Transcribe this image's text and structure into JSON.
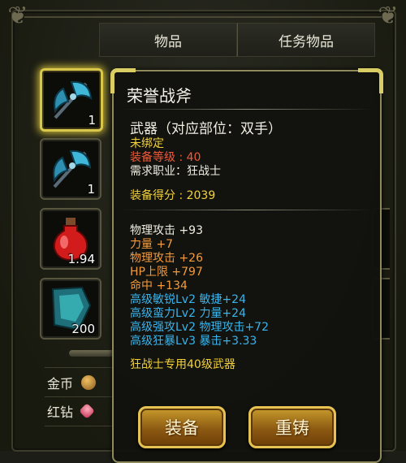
{
  "tabs": [
    {
      "label": "物品"
    },
    {
      "label": "任务物品"
    }
  ],
  "inventory": [
    {
      "icon": "battle-axe-icon",
      "qty": "1",
      "selected": true
    },
    {
      "icon": "battle-axe-icon",
      "qty": "1",
      "selected": false
    },
    {
      "icon": "red-potion-icon",
      "qty": "1.94",
      "selected": false
    },
    {
      "icon": "blue-crystal-icon",
      "qty": "200",
      "selected": false
    }
  ],
  "currency": [
    {
      "label": "金币",
      "icon": "gold-coin-icon",
      "color": "#c9963a"
    },
    {
      "label": "红钻",
      "icon": "red-diamond-icon",
      "color": "#e03a5a"
    }
  ],
  "tooltip": {
    "title": "荣誉战斧",
    "type_line": "武器（对应部位：双手）",
    "bind_status": "未绑定",
    "level_label": "装备等级 : ",
    "level_value": "40",
    "job_line": "需求职业：狂战士",
    "score_line": "装备得分 : 2039",
    "base_stat": "物理攻击 +93",
    "bonus_stats": [
      {
        "text": "力量 +7",
        "color": "orange"
      },
      {
        "text": "物理攻击 +26",
        "color": "orange"
      },
      {
        "text": "HP上限 +797",
        "color": "orange"
      },
      {
        "text": "命中 +134",
        "color": "orange"
      },
      {
        "text": "高级敏锐Lv2 敏捷+24",
        "color": "cyan"
      },
      {
        "text": "高级蛮力Lv2 力量+24",
        "color": "cyan"
      },
      {
        "text": "高级强攻Lv2 物理攻击+72",
        "color": "cyan"
      },
      {
        "text": "高级狂暴Lv3 暴击+3.33",
        "color": "cyan"
      }
    ],
    "footer": "狂战士专用40级武器",
    "equip_button": "装备",
    "recast_button": "重铸"
  }
}
